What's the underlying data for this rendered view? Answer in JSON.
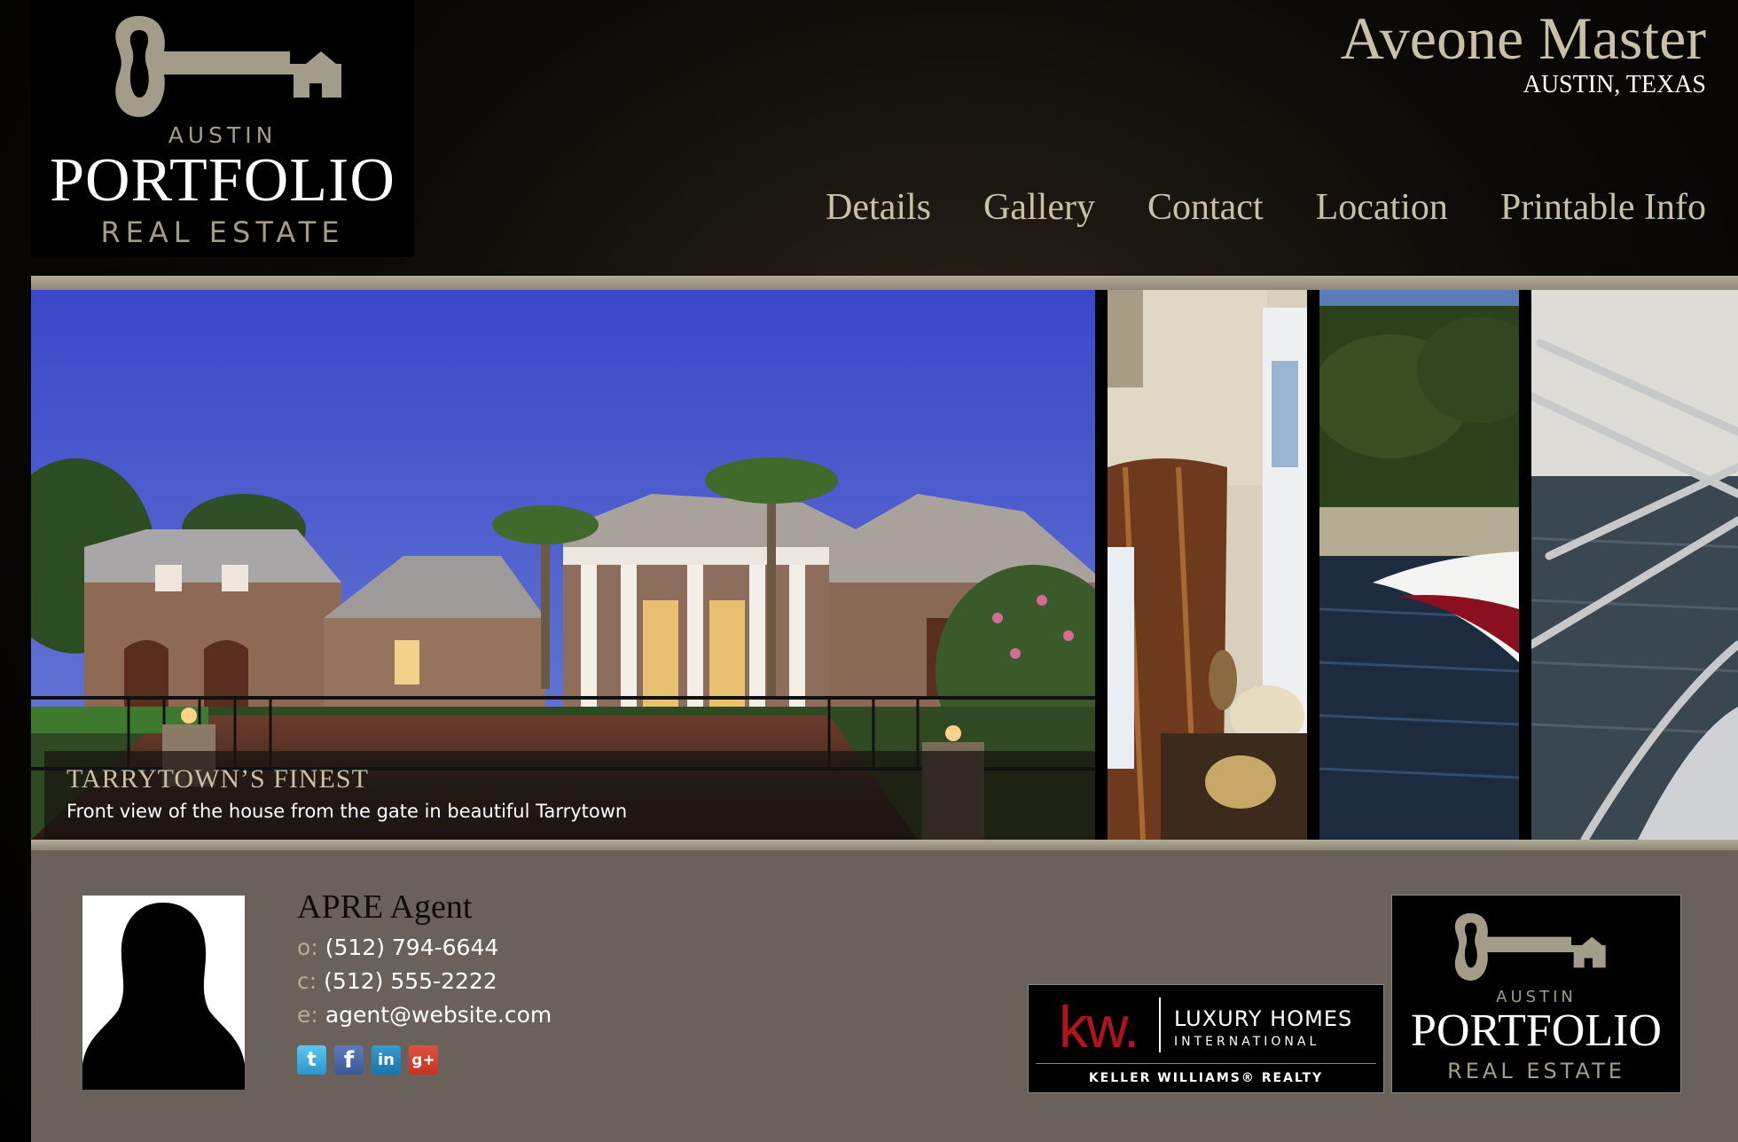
{
  "brand": {
    "austin": "AUSTIN",
    "portfolio": "PORTFOLIO",
    "real_estate": "REAL ESTATE"
  },
  "property": {
    "title": "Aveone Master",
    "location": "AUSTIN, TEXAS"
  },
  "nav": [
    {
      "label": "Details"
    },
    {
      "label": "Gallery"
    },
    {
      "label": "Contact"
    },
    {
      "label": "Location"
    },
    {
      "label": "Printable Info"
    }
  ],
  "slideshow": {
    "caption_title": "TARRYTOWN’S FINEST",
    "caption_desc": "Front view of the house from the gate in beautiful Tarrytown",
    "thumbnails": [
      "interior-curtains",
      "lake-boat",
      "boat-rail-water"
    ]
  },
  "agent": {
    "name": "APRE Agent",
    "office_prefix": "o:",
    "office": "(512) 794-6644",
    "cell_prefix": "c:",
    "cell": "(512) 555-2222",
    "email_prefix": "e:",
    "email": "agent@website.com"
  },
  "social": [
    {
      "icon": "twitter-icon",
      "glyph": "t"
    },
    {
      "icon": "facebook-icon",
      "glyph": "f"
    },
    {
      "icon": "linkedin-icon",
      "glyph": "in"
    },
    {
      "icon": "googleplus-icon",
      "glyph": "g+"
    }
  ],
  "partner": {
    "kw": "kw.",
    "luxury": "LUXURY HOMES",
    "international": "INTERNATIONAL",
    "keller": "KELLER WILLIAMS® REALTY"
  },
  "colors": {
    "accent": "#c9c0a8",
    "panel": "#6a625a",
    "band": "#a39c88"
  }
}
